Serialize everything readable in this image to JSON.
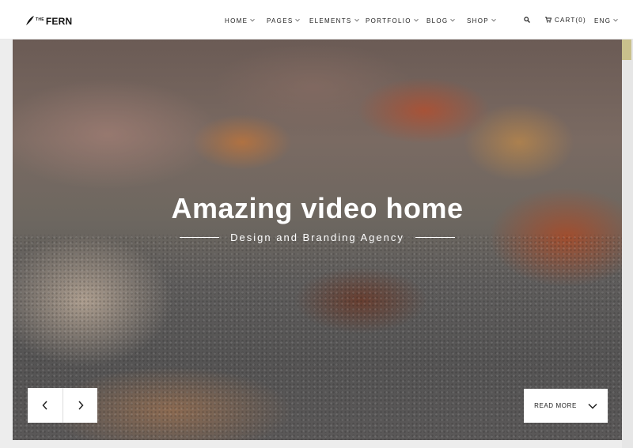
{
  "brand": {
    "small": "THE",
    "name": "FERN"
  },
  "nav": {
    "items": [
      {
        "label": "HOME"
      },
      {
        "label": "PAGES"
      },
      {
        "label": "ELEMENTS"
      },
      {
        "label": "PORTFOLIO"
      },
      {
        "label": "BLOG"
      },
      {
        "label": "SHOP"
      }
    ],
    "cart_label": "CART(0)",
    "lang_label": "ENG"
  },
  "hero": {
    "title": "Amazing video home",
    "subtitle": "Design and Branding Agency",
    "read_more_label": "READ MORE"
  }
}
